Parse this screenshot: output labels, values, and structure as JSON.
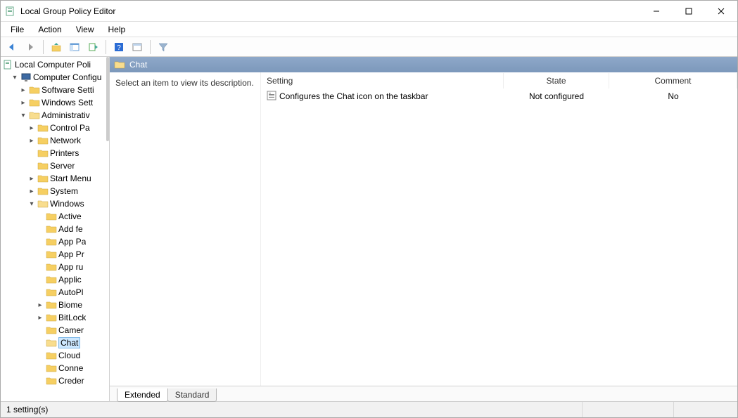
{
  "window": {
    "title": "Local Group Policy Editor"
  },
  "menu": {
    "file": "File",
    "action": "Action",
    "view": "View",
    "help": "Help"
  },
  "tree": {
    "root": "Local Computer Poli",
    "computer_config": "Computer Configu",
    "software_settings": "Software Setti",
    "windows_settings": "Windows Sett",
    "admin_templates": "Administrativ",
    "control_panel": "Control Pa",
    "network": "Network",
    "printers": "Printers",
    "server": "Server",
    "start_menu": "Start Menu",
    "system": "System",
    "windows_comp": "Windows",
    "active": "Active",
    "add_fe": "Add fe",
    "app_pa": "App Pa",
    "app_pr": "App Pr",
    "app_ru": "App ru",
    "applic": "Applic",
    "autopl": "AutoPl",
    "biome": "Biome",
    "bitlock": "BitLock",
    "camer": "Camer",
    "chat": "Chat",
    "cloud": "Cloud",
    "conne": "Conne",
    "creder": "Creder"
  },
  "pane": {
    "header": "Chat",
    "description_prompt": "Select an item to view its description."
  },
  "columns": {
    "setting": "Setting",
    "state": "State",
    "comment": "Comment"
  },
  "rows": [
    {
      "setting": "Configures the Chat icon on the taskbar",
      "state": "Not configured",
      "comment": "No"
    }
  ],
  "tabs": {
    "extended": "Extended",
    "standard": "Standard"
  },
  "status": {
    "text": "1 setting(s)"
  }
}
